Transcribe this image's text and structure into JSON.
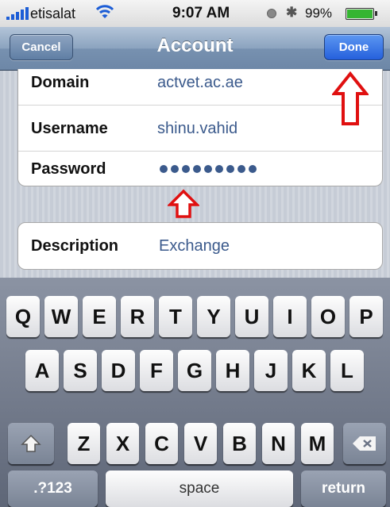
{
  "status_bar": {
    "carrier": "etisalat",
    "time": "9:07 AM",
    "battery_percent": "99%",
    "battery_level": 0.99,
    "icons": [
      "signal-icon",
      "wifi-icon",
      "lock-rotation-icon",
      "bluetooth-icon",
      "battery-icon"
    ]
  },
  "navbar": {
    "cancel_label": "Cancel",
    "title": "Account",
    "done_label": "Done"
  },
  "form": {
    "domain": {
      "label": "Domain",
      "value": "actvet.ac.ae"
    },
    "username": {
      "label": "Username",
      "value": "shinu.vahid"
    },
    "password": {
      "label": "Password",
      "masked_length": 9
    },
    "description": {
      "label": "Description",
      "value": "Exchange"
    }
  },
  "keyboard": {
    "row1": [
      "Q",
      "W",
      "E",
      "R",
      "T",
      "Y",
      "U",
      "I",
      "O",
      "P"
    ],
    "row2": [
      "A",
      "S",
      "D",
      "F",
      "G",
      "H",
      "J",
      "K",
      "L"
    ],
    "row3": [
      "Z",
      "X",
      "C",
      "V",
      "B",
      "N",
      "M"
    ],
    "numbers_label": ".?123",
    "space_label": "space",
    "return_label": "return",
    "shift_icon": "shift-arrow-icon",
    "delete_icon": "backspace-icon"
  },
  "annotations": {
    "color": "#e01010",
    "arrows": [
      "arrow-to-done-button",
      "arrow-to-password-field"
    ]
  }
}
